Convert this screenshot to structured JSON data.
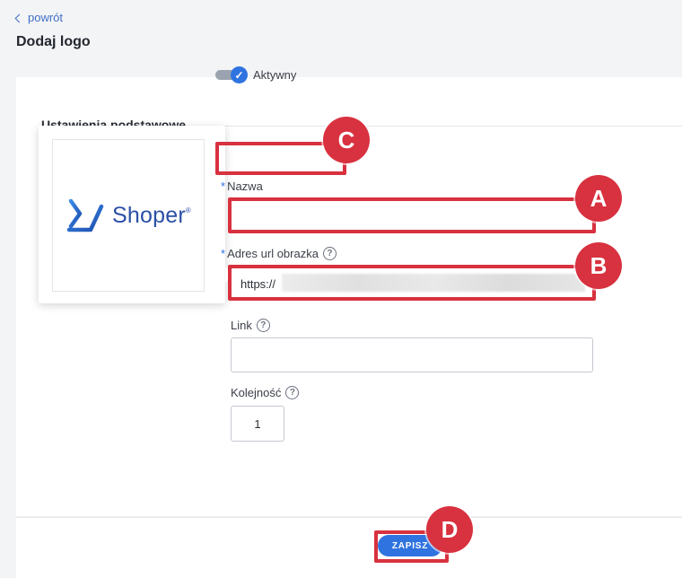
{
  "nav": {
    "back_label": "powrót"
  },
  "page": {
    "title": "Dodaj logo"
  },
  "section": {
    "title": "Ustawienia podstawowe"
  },
  "logo_preview": {
    "brand_text": "Shoper",
    "brand_mark": "®"
  },
  "form": {
    "active": {
      "label": "Aktywny",
      "checked": true
    },
    "name": {
      "label": "Nazwa",
      "required": true,
      "value": ""
    },
    "image_url": {
      "label": "Adres url obrazka",
      "required": true,
      "value_prefix": "https://"
    },
    "link": {
      "label": "Link",
      "value": ""
    },
    "order": {
      "label": "Kolejność",
      "value": "1"
    }
  },
  "footer": {
    "save_label": "ZAPISZ"
  },
  "annotations": {
    "a": "A",
    "b": "B",
    "c": "C",
    "d": "D"
  },
  "colors": {
    "accent": "#2f73e0",
    "highlight": "#d8313f",
    "brand": "#2b4fa6"
  },
  "icons": {
    "back": "chevron-left-icon",
    "help": "question-circle-icon",
    "check": "check-icon"
  }
}
